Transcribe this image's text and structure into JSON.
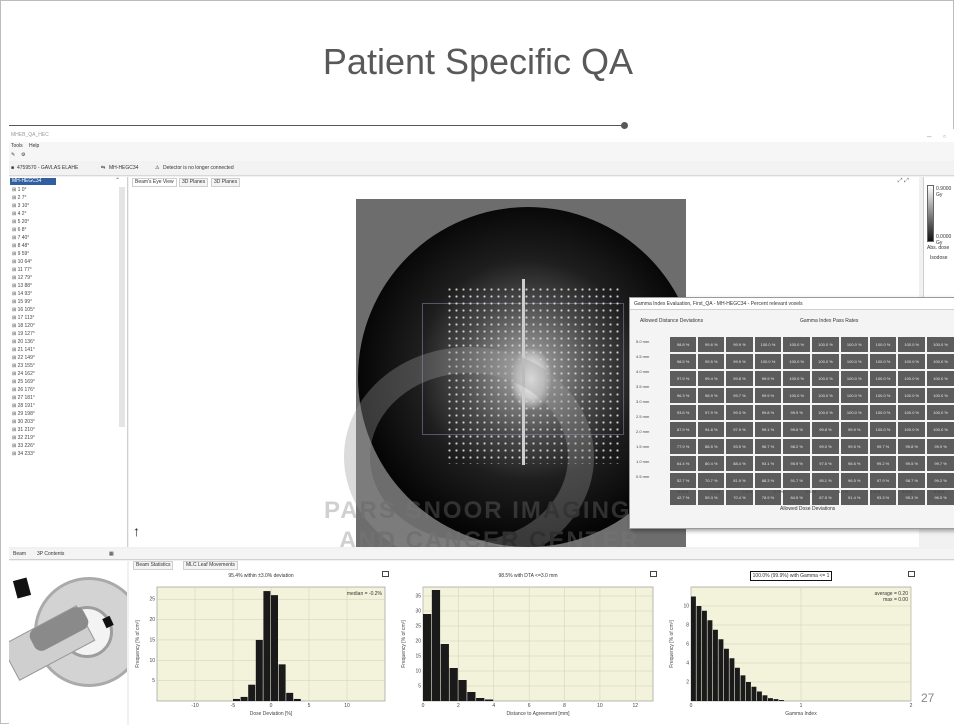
{
  "slide": {
    "title": "Patient Specific QA",
    "page_number": "27"
  },
  "app": {
    "window_title": "MHEB_QA_HEC",
    "menu": [
      "Tools",
      "Help"
    ],
    "toolbar_icons": [
      "edit-icon",
      "settings-icon"
    ],
    "status_line": {
      "patient": "4759570 - GAVLAS ELAHE",
      "plan": "MH-HEGC34",
      "warning": "Detector is no longer connected"
    },
    "tree": {
      "root": "MH-HEGC34",
      "items": [
        "1 0°",
        "2 7°",
        "3 10°",
        "4 2°",
        "5 20°",
        "6 8°",
        "7 40°",
        "8 48°",
        "9 59°",
        "10 64°",
        "11 77°",
        "12 79°",
        "13 88°",
        "14 93°",
        "15 99°",
        "16 105°",
        "17 113°",
        "18 120°",
        "19 127°",
        "20 136°",
        "21 141°",
        "22 149°",
        "23 155°",
        "24 162°",
        "25 169°",
        "26 176°",
        "27 181°",
        "28 191°",
        "29 198°",
        "30 203°",
        "31 210°",
        "32 219°",
        "33 226°",
        "34 233°"
      ]
    },
    "viewer_tabs": [
      "Beam's Eye View",
      "3D Planes",
      "3D Planes"
    ],
    "right_panel": {
      "max": "0.9000 Gy",
      "min": "0.0000 Gy",
      "abs_dose": "Abs. dose",
      "isodose": "Isodose"
    },
    "watermark": {
      "line1": "PARS SNOOR IMAGING",
      "line2": "AND CANCER CENTER"
    },
    "gamma_dialog": {
      "title": "Gamma Index Evaluation, First_QA - MH-HEGC34 - Percent relevant voxels",
      "left_header": "Allowed Distance Deviations",
      "right_header": "Gamma Index Pass Rates",
      "row_labels": [
        "5.0 mm",
        "4.5 mm",
        "4.0 mm",
        "3.5 mm",
        "3.0 mm",
        "2.5 mm",
        "2.0 mm",
        "1.5 mm",
        "1.0 mm",
        "0.5 mm"
      ],
      "col_labels": [
        "0.5 %",
        "1.0 %",
        "1.5 %",
        "2.0 %",
        "2.5 %",
        "3.0 %",
        "3.5 %",
        "4.0 %",
        "4.5 %",
        "5.0 %"
      ],
      "cells": [
        [
          "98.8 %",
          "99.6 %",
          "99.9 %",
          "100.0 %",
          "100.0 %",
          "100.0 %",
          "100.0 %",
          "100.0 %",
          "100.0 %",
          "100.0 %"
        ],
        [
          "98.5 %",
          "99.5 %",
          "99.9 %",
          "100.0 %",
          "100.0 %",
          "100.0 %",
          "100.0 %",
          "100.0 %",
          "100.0 %",
          "100.0 %"
        ],
        [
          "97.9 %",
          "99.4 %",
          "99.8 %",
          "99.9 %",
          "100.0 %",
          "100.0 %",
          "100.0 %",
          "100.0 %",
          "100.0 %",
          "100.0 %"
        ],
        [
          "96.3 %",
          "98.9 %",
          "99.7 %",
          "99.9 %",
          "100.0 %",
          "100.0 %",
          "100.0 %",
          "100.0 %",
          "100.0 %",
          "100.0 %"
        ],
        [
          "93.6 %",
          "97.9 %",
          "99.3 %",
          "99.8 %",
          "99.9 %",
          "100.0 %",
          "100.0 %",
          "100.0 %",
          "100.0 %",
          "100.0 %"
        ],
        [
          "87.9 %",
          "94.8 %",
          "97.9 %",
          "99.1 %",
          "99.6 %",
          "99.8 %",
          "99.9 %",
          "100.0 %",
          "100.0 %",
          "100.0 %"
        ],
        [
          "77.9 %",
          "88.5 %",
          "93.9 %",
          "96.7 %",
          "98.2 %",
          "99.0 %",
          "99.5 %",
          "99.7 %",
          "99.8 %",
          "99.9 %"
        ],
        [
          "64.4 %",
          "80.4 %",
          "88.4 %",
          "93.1 %",
          "95.9 %",
          "97.6 %",
          "98.6 %",
          "99.2 %",
          "99.5 %",
          "99.7 %"
        ],
        [
          "52.7 %",
          "70.7 %",
          "81.9 %",
          "88.3 %",
          "91.7 %",
          "95.1 %",
          "96.5 %",
          "97.9 %",
          "98.7 %",
          "99.2 %"
        ],
        [
          "42.7 %",
          "59.3 %",
          "70.4 %",
          "78.9 %",
          "84.5 %",
          "87.5 %",
          "91.4 %",
          "93.3 %",
          "95.3 %",
          "96.5 %"
        ]
      ],
      "bottom_header": "Allowed Dose Deviations"
    },
    "bottom_tabs_left": [
      "Beam",
      "3P Contents"
    ],
    "bottom_tabs_right": [
      "Beam Statistics",
      "MLC Leaf Movements"
    ],
    "charts_titles": {
      "c1": "95.4% within ±3.0% deviation",
      "c2": "98.5% with DTA <=3.0 mm",
      "c3": "100.0% (99.9%) with Gamma <= 1"
    },
    "footer": "Info   99% - 1799/ns"
  },
  "chart_data": [
    {
      "type": "bar",
      "title": "95.4% within ±3.0% deviation",
      "xlabel": "Dose Deviation [%]",
      "ylabel": "Frequency [% of cm³]",
      "annotation": "median = -0.2%",
      "xlim": [
        -15,
        15
      ],
      "ylim": [
        0,
        28
      ],
      "x_ticks": [
        "-10",
        "-5",
        "0",
        "5",
        "10"
      ],
      "y_ticks": [
        "5",
        "10",
        "15",
        "20",
        "25"
      ],
      "bins": [
        -4.5,
        -3.5,
        -2.5,
        -1.5,
        -0.5,
        0.5,
        1.5,
        2.5,
        3.5
      ],
      "values": [
        0.5,
        1.0,
        4.0,
        15.0,
        27.0,
        26.0,
        9.0,
        2.0,
        0.5
      ]
    },
    {
      "type": "bar",
      "title": "98.5% with DTA <=3.0 mm",
      "xlabel": "Distance to Agreement [mm]",
      "ylabel": "Frequency [% of cm³]",
      "xlim": [
        0,
        13
      ],
      "ylim": [
        0,
        38
      ],
      "x_ticks": [
        "0",
        "2",
        "4",
        "6",
        "8",
        "10",
        "12"
      ],
      "y_ticks": [
        "5",
        "10",
        "15",
        "20",
        "25",
        "30",
        "35"
      ],
      "bins": [
        0.25,
        0.75,
        1.25,
        1.75,
        2.25,
        2.75,
        3.25,
        3.75
      ],
      "values": [
        29,
        37,
        19,
        11,
        7,
        3,
        1,
        0.5
      ]
    },
    {
      "type": "bar",
      "title": "100.0% (99.9%) with Gamma <= 1",
      "xlabel": "Gamma Index",
      "ylabel": "Frequency [% of cm³]",
      "annotation_lines": [
        "average = 0.20",
        "max = 0.00"
      ],
      "xlim": [
        0,
        2
      ],
      "ylim": [
        0,
        12
      ],
      "x_ticks": [
        "0",
        "1",
        "2"
      ],
      "y_ticks": [
        "2",
        "4",
        "6",
        "8",
        "10"
      ],
      "bins": [
        0.025,
        0.075,
        0.125,
        0.175,
        0.225,
        0.275,
        0.325,
        0.375,
        0.425,
        0.475,
        0.525,
        0.575,
        0.625,
        0.675,
        0.725,
        0.775,
        0.825
      ],
      "values": [
        11,
        10,
        9.5,
        8.5,
        7.5,
        6.5,
        5.5,
        4.5,
        3.5,
        2.7,
        2.0,
        1.5,
        1.0,
        0.6,
        0.3,
        0.2,
        0.1
      ]
    }
  ]
}
